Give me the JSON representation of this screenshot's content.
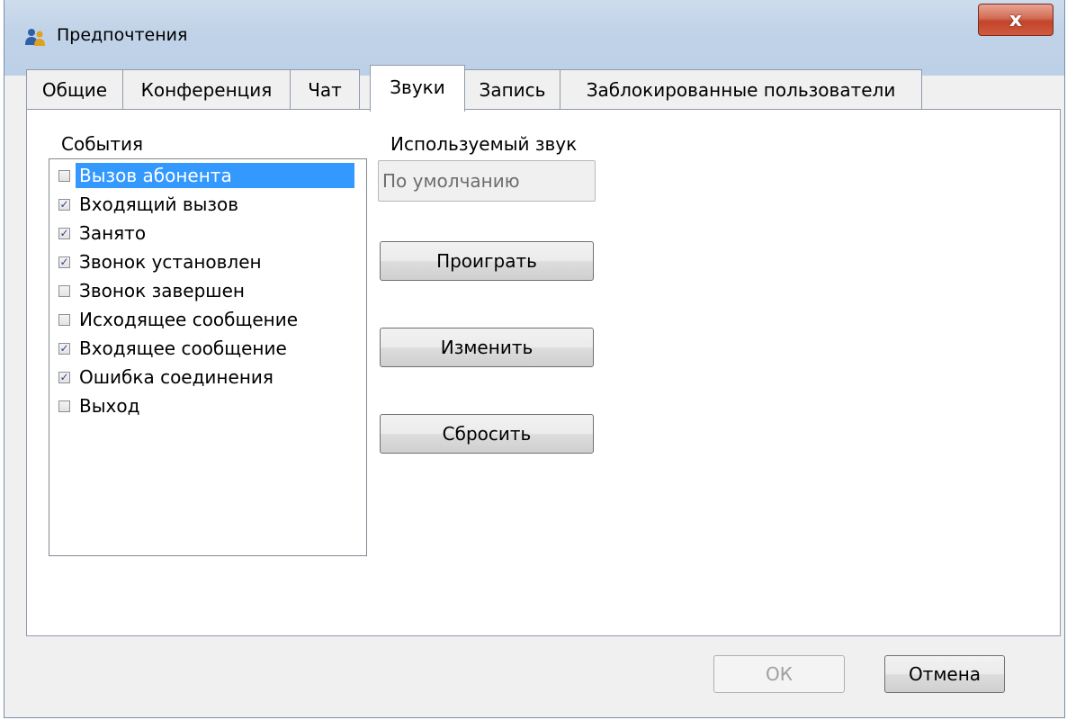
{
  "window": {
    "title": "Предпочтения",
    "close_label": "x"
  },
  "tabs": [
    {
      "label": "Общие"
    },
    {
      "label": "Конференция"
    },
    {
      "label": "Чат"
    },
    {
      "label": "Звуки"
    },
    {
      "label": "Запись"
    },
    {
      "label": "Заблокированные пользователи"
    }
  ],
  "sounds": {
    "events_label": "События",
    "sound_label": "Используемый звук",
    "sound_value": "По умолчанию",
    "events": [
      {
        "label": "Вызов абонента",
        "checked": false,
        "selected": true
      },
      {
        "label": "Входящий вызов",
        "checked": true,
        "selected": false
      },
      {
        "label": "Занято",
        "checked": true,
        "selected": false
      },
      {
        "label": "Звонок установлен",
        "checked": true,
        "selected": false
      },
      {
        "label": "Звонок завершен",
        "checked": false,
        "selected": false
      },
      {
        "label": "Исходящее сообщение",
        "checked": false,
        "selected": false
      },
      {
        "label": "Входящее сообщение",
        "checked": true,
        "selected": false
      },
      {
        "label": "Ошибка соединения",
        "checked": true,
        "selected": false
      },
      {
        "label": "Выход",
        "checked": false,
        "selected": false
      }
    ],
    "play_label": "Проиграть",
    "change_label": "Изменить",
    "reset_label": "Сбросить"
  },
  "footer": {
    "ok_label": "ОК",
    "cancel_label": "Отмена"
  },
  "colors": {
    "selection": "#3399ff",
    "close_button": "#c3442a"
  },
  "icons": {
    "title": "users-icon",
    "close": "close-icon"
  }
}
